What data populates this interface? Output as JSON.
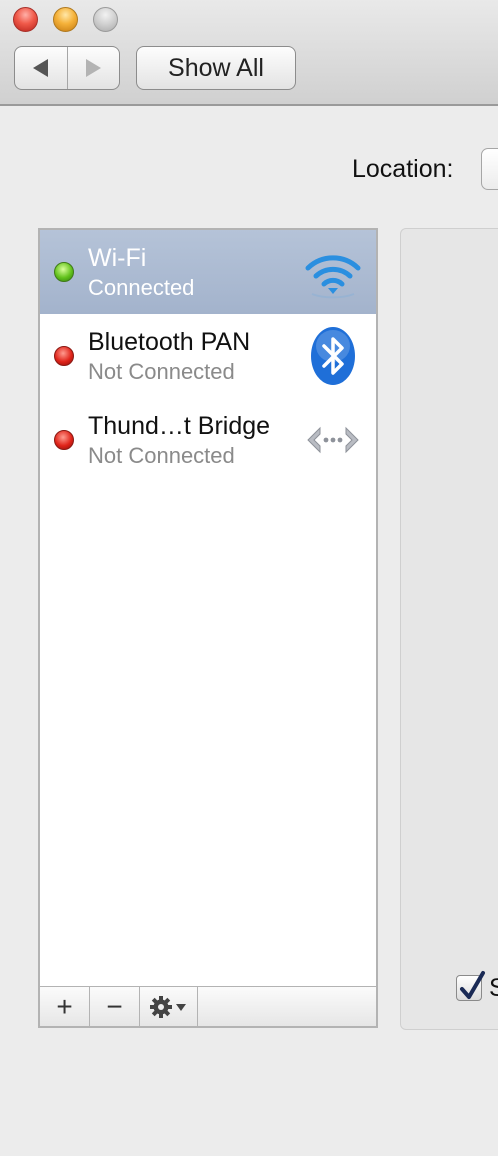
{
  "toolbar": {
    "back_icon": "back-arrow-icon",
    "forward_icon": "forward-arrow-icon",
    "show_all_label": "Show All"
  },
  "location": {
    "label": "Location:"
  },
  "services": [
    {
      "name": "Wi-Fi",
      "status": "Connected",
      "status_color": "#62c21c",
      "icon": "wifi-icon",
      "selected": true
    },
    {
      "name": "Bluetooth PAN",
      "status": "Not Connected",
      "status_color": "#e0241a",
      "icon": "bluetooth-icon",
      "selected": false
    },
    {
      "name": "Thund…t Bridge",
      "status": "Not Connected",
      "status_color": "#e0241a",
      "icon": "thunderbolt-bridge-icon",
      "selected": false
    }
  ],
  "list_controls": {
    "add_label": "+",
    "remove_label": "−",
    "gear_icon": "gear-icon"
  },
  "detail": {
    "checkbox_label": "S",
    "checkbox_checked": true
  },
  "colors": {
    "selection": "#a3b3cc",
    "bluetooth_blue": "#1f6fd8"
  }
}
